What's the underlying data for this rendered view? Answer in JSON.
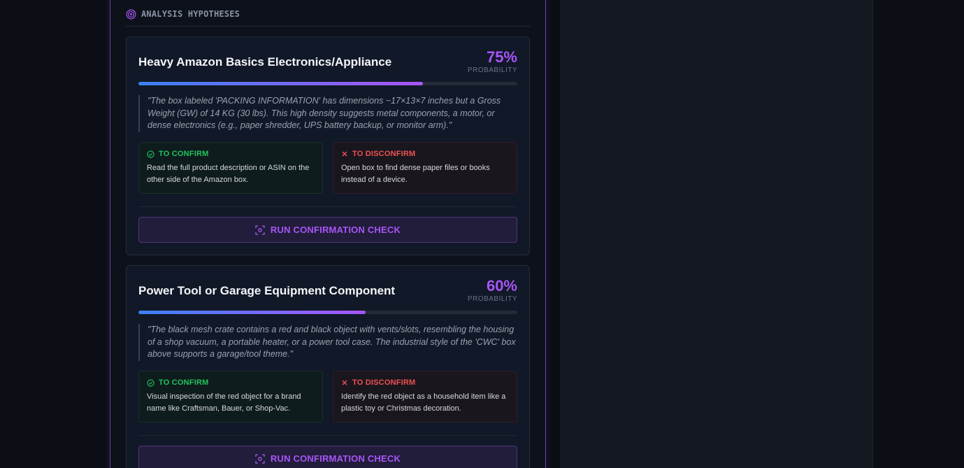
{
  "section": {
    "title": "ANALYSIS HYPOTHESES",
    "icon": "target-icon"
  },
  "hypotheses": [
    {
      "title": "Heavy Amazon Basics Electronics/Appliance",
      "probability": "75%",
      "probability_value": 0.75,
      "probability_label": "PROBABILITY",
      "quote": "\"The box labeled 'PACKING INFORMATION' has dimensions ~17×13×7 inches but a Gross Weight (GW) of 14 KG (30 lbs). This high density suggests metal components, a motor, or dense electronics (e.g., paper shredder, UPS battery backup, or monitor arm).\"",
      "confirm_label": "TO CONFIRM",
      "confirm_text": "Read the full product description or ASIN on the other side of the Amazon box.",
      "disconfirm_label": "TO DISCONFIRM",
      "disconfirm_text": "Open box to find dense paper files or books instead of a device.",
      "button_label": "RUN CONFIRMATION CHECK"
    },
    {
      "title": "Power Tool or Garage Equipment Component",
      "probability": "60%",
      "probability_value": 0.6,
      "probability_label": "PROBABILITY",
      "quote": "\"The black mesh crate contains a red and black object with vents/slots, resembling the housing of a shop vacuum, a portable heater, or a power tool case. The industrial style of the 'CWC' box above supports a garage/tool theme.\"",
      "confirm_label": "TO CONFIRM",
      "confirm_text": "Visual inspection of the red object for a brand name like Craftsman, Bauer, or Shop-Vac.",
      "disconfirm_label": "TO DISCONFIRM",
      "disconfirm_text": "Identify the red object as a household item like a plastic toy or Christmas decoration.",
      "button_label": "RUN CONFIRMATION CHECK"
    }
  ],
  "colors": {
    "accent": "#a855f7",
    "bar_start": "#3b82f6",
    "confirm": "#22c55e",
    "disconfirm": "#f05252",
    "panel_border": "#6b3fb0"
  }
}
